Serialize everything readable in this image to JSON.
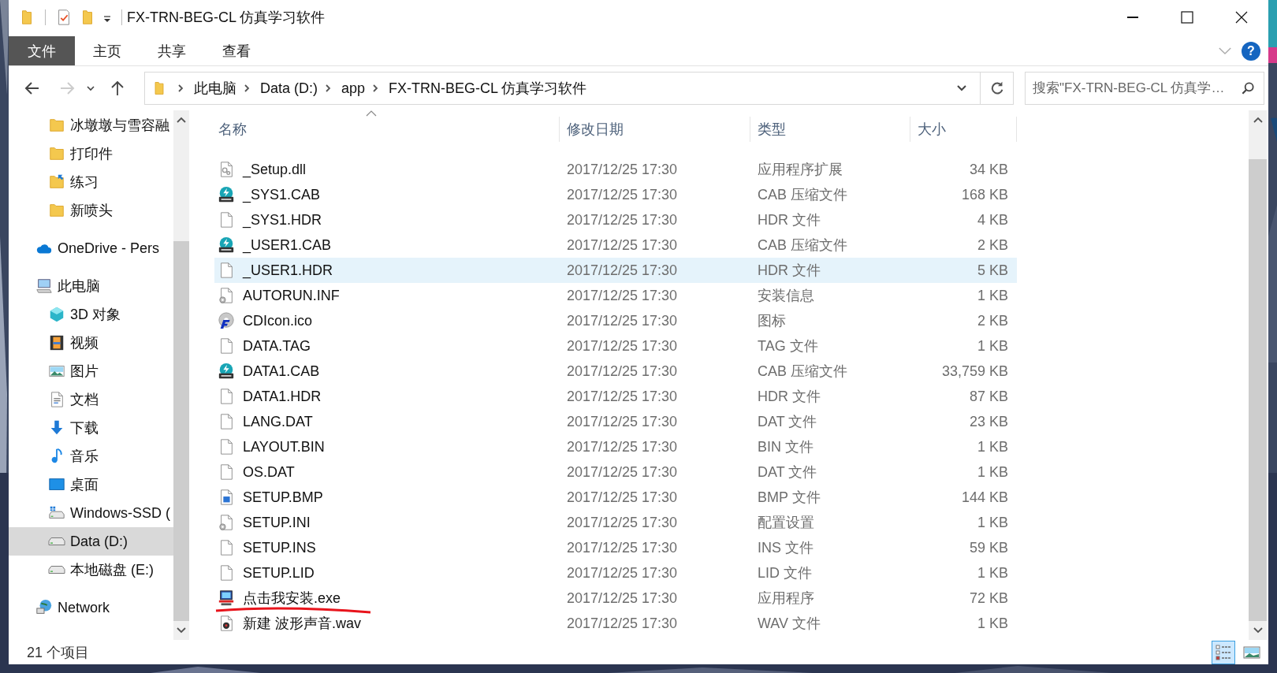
{
  "window": {
    "title": "FX-TRN-BEG-CL 仿真学习软件"
  },
  "ribbon": {
    "file_button": "文件",
    "tabs": [
      {
        "label": "主页",
        "selected": false
      },
      {
        "label": "共享",
        "selected": false
      },
      {
        "label": "查看",
        "selected": false
      }
    ],
    "help": "?"
  },
  "address_bar": {
    "segments": [
      "此电脑",
      "Data (D:)",
      "app",
      "FX-TRN-BEG-CL 仿真学习软件"
    ]
  },
  "search": {
    "placeholder": "搜索\"FX-TRN-BEG-CL 仿真学…"
  },
  "nav": {
    "pinned": [
      {
        "label": "冰墩墩与雪容融",
        "kind": "folder"
      },
      {
        "label": "打印件",
        "kind": "folder"
      },
      {
        "label": "练习",
        "kind": "folder-sync"
      },
      {
        "label": "新喷头",
        "kind": "folder"
      }
    ],
    "tree": [
      {
        "label": "OneDrive - Pers",
        "kind": "cloud",
        "selected": false
      },
      {
        "label": "此电脑",
        "kind": "pc",
        "selected": false,
        "children": [
          {
            "label": "3D 对象",
            "kind": "cube",
            "selected": false
          },
          {
            "label": "视频",
            "kind": "video",
            "selected": false
          },
          {
            "label": "图片",
            "kind": "pictures",
            "selected": false
          },
          {
            "label": "文档",
            "kind": "docs",
            "selected": false
          },
          {
            "label": "下载",
            "kind": "download",
            "selected": false
          },
          {
            "label": "音乐",
            "kind": "music",
            "selected": false
          },
          {
            "label": "桌面",
            "kind": "desktop",
            "selected": false
          },
          {
            "label": "Windows-SSD (",
            "kind": "drive-win",
            "selected": false
          },
          {
            "label": "Data (D:)",
            "kind": "drive",
            "selected": true
          },
          {
            "label": "本地磁盘 (E:)",
            "kind": "drive",
            "selected": false
          }
        ]
      },
      {
        "label": "Network",
        "kind": "network",
        "selected": false
      }
    ]
  },
  "columns": [
    {
      "label": "名称",
      "sorted": true
    },
    {
      "label": "修改日期",
      "sorted": false
    },
    {
      "label": "类型",
      "sorted": false
    },
    {
      "label": "大小",
      "sorted": false
    }
  ],
  "rows": [
    {
      "name": "_Setup.dll",
      "date": "2017/12/25 17:30",
      "type": "应用程序扩展",
      "size": "34 KB",
      "kind": "dll",
      "selected": false,
      "underlined": false
    },
    {
      "name": "_SYS1.CAB",
      "date": "2017/12/25 17:30",
      "type": "CAB 压缩文件",
      "size": "168 KB",
      "kind": "cab",
      "selected": false,
      "underlined": false
    },
    {
      "name": "_SYS1.HDR",
      "date": "2017/12/25 17:30",
      "type": "HDR 文件",
      "size": "4 KB",
      "kind": "blank",
      "selected": false,
      "underlined": false
    },
    {
      "name": "_USER1.CAB",
      "date": "2017/12/25 17:30",
      "type": "CAB 压缩文件",
      "size": "2 KB",
      "kind": "cab",
      "selected": false,
      "underlined": false
    },
    {
      "name": "_USER1.HDR",
      "date": "2017/12/25 17:30",
      "type": "HDR 文件",
      "size": "5 KB",
      "kind": "blank",
      "selected": true,
      "underlined": false
    },
    {
      "name": "AUTORUN.INF",
      "date": "2017/12/25 17:30",
      "type": "安装信息",
      "size": "1 KB",
      "kind": "config",
      "selected": false,
      "underlined": false
    },
    {
      "name": "CDIcon.ico",
      "date": "2017/12/25 17:30",
      "type": "图标",
      "size": "2 KB",
      "kind": "ico",
      "selected": false,
      "underlined": false
    },
    {
      "name": "DATA.TAG",
      "date": "2017/12/25 17:30",
      "type": "TAG 文件",
      "size": "1 KB",
      "kind": "blank",
      "selected": false,
      "underlined": false
    },
    {
      "name": "DATA1.CAB",
      "date": "2017/12/25 17:30",
      "type": "CAB 压缩文件",
      "size": "33,759 KB",
      "kind": "cab",
      "selected": false,
      "underlined": false
    },
    {
      "name": "DATA1.HDR",
      "date": "2017/12/25 17:30",
      "type": "HDR 文件",
      "size": "87 KB",
      "kind": "blank",
      "selected": false,
      "underlined": false
    },
    {
      "name": "LANG.DAT",
      "date": "2017/12/25 17:30",
      "type": "DAT 文件",
      "size": "23 KB",
      "kind": "blank",
      "selected": false,
      "underlined": false
    },
    {
      "name": "LAYOUT.BIN",
      "date": "2017/12/25 17:30",
      "type": "BIN 文件",
      "size": "1 KB",
      "kind": "blank",
      "selected": false,
      "underlined": false
    },
    {
      "name": "OS.DAT",
      "date": "2017/12/25 17:30",
      "type": "DAT 文件",
      "size": "1 KB",
      "kind": "blank",
      "selected": false,
      "underlined": false
    },
    {
      "name": "SETUP.BMP",
      "date": "2017/12/25 17:30",
      "type": "BMP 文件",
      "size": "144 KB",
      "kind": "bmp",
      "selected": false,
      "underlined": false
    },
    {
      "name": "SETUP.INI",
      "date": "2017/12/25 17:30",
      "type": "配置设置",
      "size": "1 KB",
      "kind": "config",
      "selected": false,
      "underlined": false
    },
    {
      "name": "SETUP.INS",
      "date": "2017/12/25 17:30",
      "type": "INS 文件",
      "size": "59 KB",
      "kind": "blank",
      "selected": false,
      "underlined": false
    },
    {
      "name": "SETUP.LID",
      "date": "2017/12/25 17:30",
      "type": "LID 文件",
      "size": "1 KB",
      "kind": "blank",
      "selected": false,
      "underlined": false
    },
    {
      "name": "点击我安装.exe",
      "date": "2017/12/25 17:30",
      "type": "应用程序",
      "size": "72 KB",
      "kind": "installer",
      "selected": false,
      "underlined": true
    },
    {
      "name": "新建 波形声音.wav",
      "date": "2017/12/25 17:30",
      "type": "WAV 文件",
      "size": "1 KB",
      "kind": "wav",
      "selected": false,
      "underlined": false
    }
  ],
  "status_bar": {
    "item_count": "21 个项目"
  },
  "view_buttons": [
    {
      "kind": "details",
      "selected": true
    },
    {
      "kind": "large-icons",
      "selected": false
    }
  ]
}
